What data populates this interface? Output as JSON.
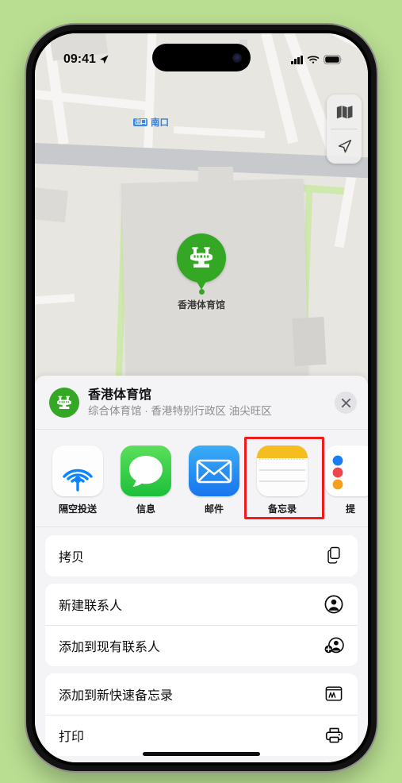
{
  "status_bar": {
    "time": "09:41",
    "location_arrow_icon": "location-arrow-icon",
    "signal_icon": "cellular-bars-icon",
    "wifi_icon": "wifi-icon",
    "battery_icon": "battery-full-icon"
  },
  "map": {
    "transit_label": "南口",
    "transit_badge": "出口",
    "pin_label": "香港体育馆",
    "pin_icon": "stadium-icon",
    "controls": [
      {
        "name": "map-style-icon",
        "label": "地图"
      },
      {
        "name": "location-arrow-icon",
        "label": "定位"
      }
    ],
    "colors": {
      "land": "#e8e6e1",
      "road": "#f6f5f3",
      "major_road": "#c7c9cd",
      "building": "#dcdad6",
      "park": "#cfe8ad",
      "pin": "#34a825",
      "transit": "#3d87e8"
    }
  },
  "share_sheet": {
    "title": "香港体育馆",
    "subtitle": "综合体育馆 · 香港特别行政区 油尖旺区",
    "place_icon": "stadium-icon",
    "close_label": "关闭",
    "apps": [
      {
        "label": "隔空投送",
        "icon": "airdrop-icon",
        "highlighted": false
      },
      {
        "label": "信息",
        "icon": "messages-icon",
        "highlighted": false
      },
      {
        "label": "邮件",
        "icon": "mail-icon",
        "highlighted": false
      },
      {
        "label": "备忘录",
        "icon": "notes-icon",
        "highlighted": true
      },
      {
        "label": "提",
        "icon": "reminders-icon",
        "highlighted": false
      }
    ],
    "actions": [
      {
        "label": "拷贝",
        "icon": "copy-icon"
      },
      {
        "label": "新建联系人",
        "icon": "person-circle-icon"
      },
      {
        "label": "添加到现有联系人",
        "icon": "person-badge-plus-icon"
      },
      {
        "label": "添加到新快速备忘录",
        "icon": "quick-note-icon"
      },
      {
        "label": "打印",
        "icon": "printer-icon"
      }
    ],
    "highlight_color": "#f01b1b"
  }
}
